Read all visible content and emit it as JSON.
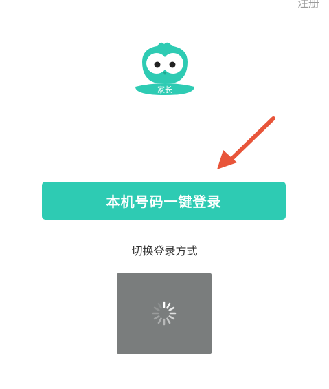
{
  "header": {
    "register_label": "注册"
  },
  "logo": {
    "badge_text": "家长",
    "brand_color": "#2ecbb3"
  },
  "main": {
    "one_click_login_label": "本机号码一键登录",
    "switch_login_label": "切换登录方式"
  },
  "annotation": {
    "arrow_color": "#e8553a"
  },
  "loading": {
    "icon": "spinner-icon",
    "overlay_color": "#7a7d7d"
  }
}
